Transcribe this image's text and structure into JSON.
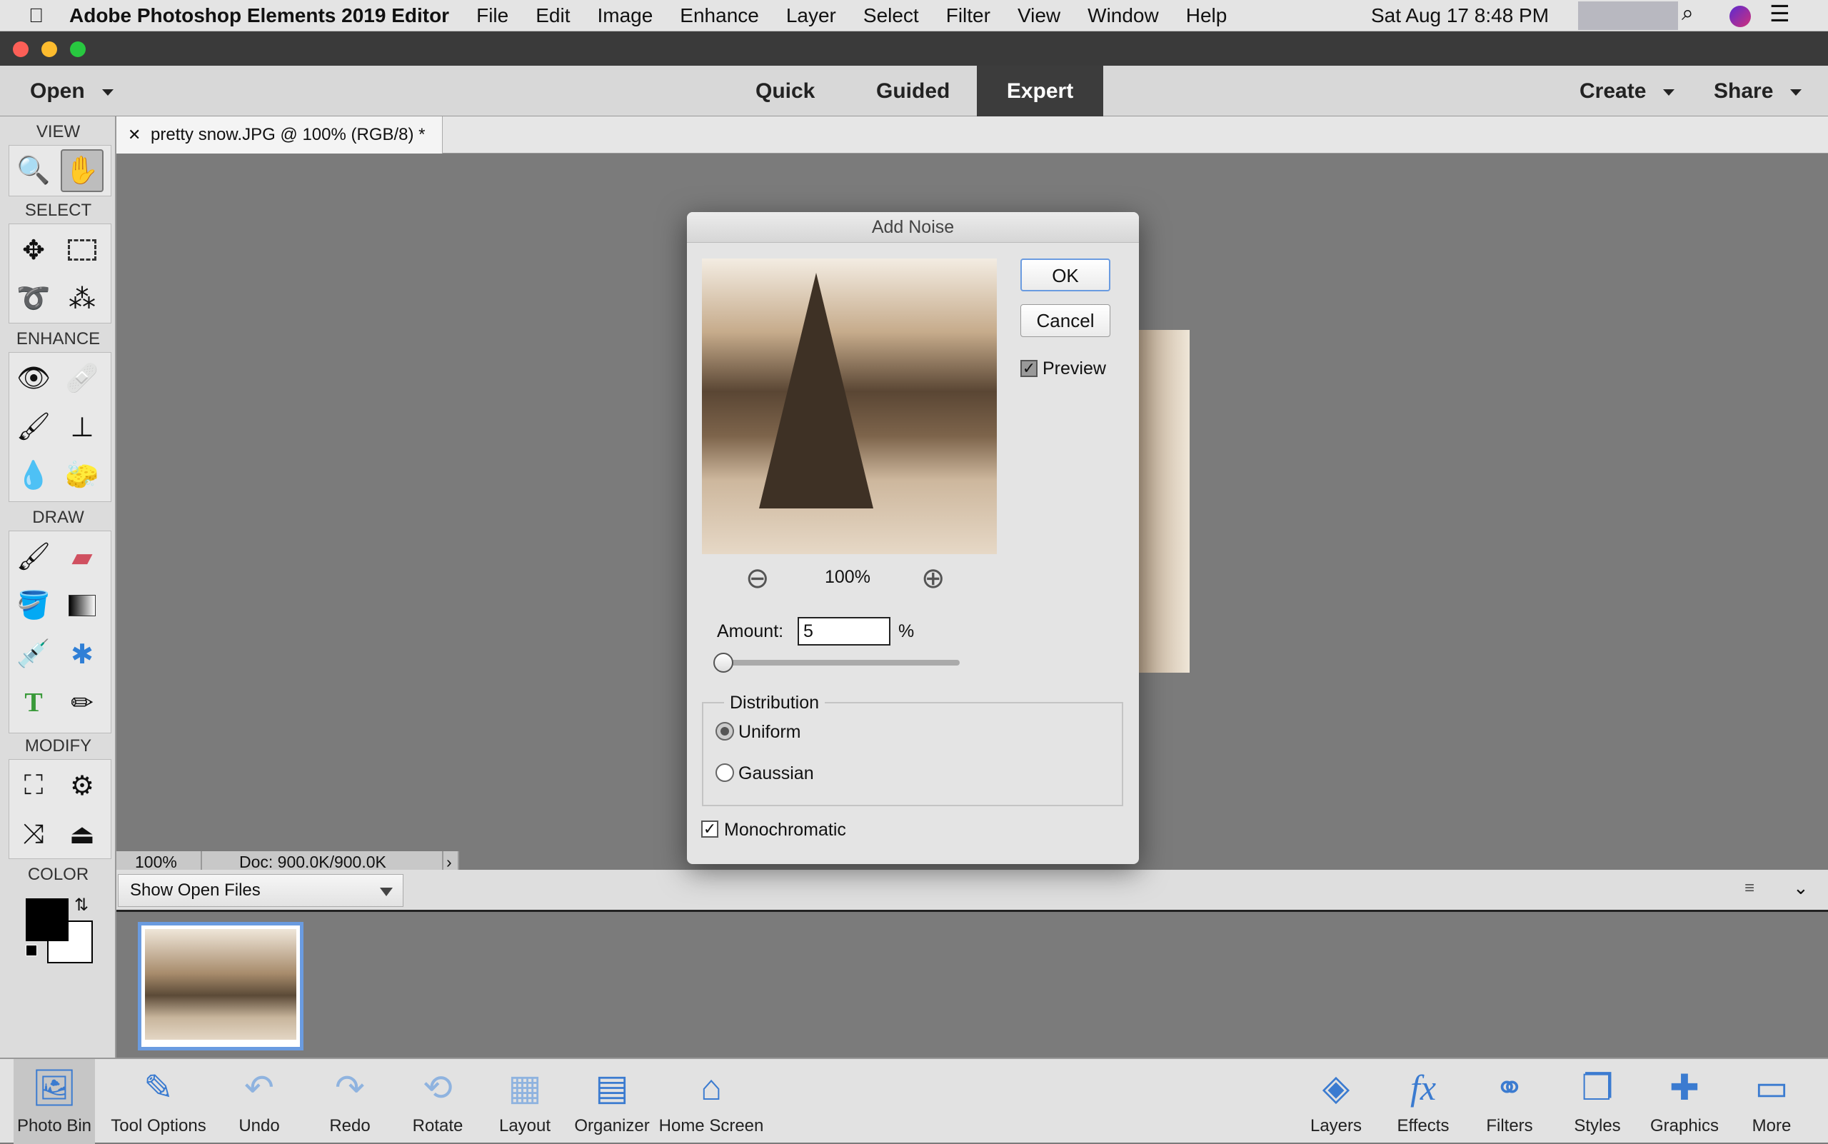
{
  "menubar": {
    "app": "Adobe Photoshop Elements 2019 Editor",
    "items": [
      "File",
      "Edit",
      "Image",
      "Enhance",
      "Layer",
      "Select",
      "Filter",
      "View",
      "Window",
      "Help"
    ],
    "datetime": "Sat Aug 17  8:48 PM"
  },
  "toolbar": {
    "open": "Open",
    "modes": [
      "Quick",
      "Guided",
      "Expert"
    ],
    "active_mode": "Expert",
    "create": "Create",
    "share": "Share"
  },
  "toolbox": {
    "sections": [
      "VIEW",
      "SELECT",
      "ENHANCE",
      "DRAW",
      "MODIFY",
      "COLOR"
    ],
    "foreground": "#000000",
    "background": "#ffffff"
  },
  "document": {
    "tab": "pretty snow.JPG @ 100% (RGB/8) *",
    "zoom": "100%",
    "doc_size": "Doc: 900.0K/900.0K"
  },
  "bin": {
    "selector": "Show Open Files"
  },
  "taskbar": {
    "left": [
      "Photo Bin",
      "Tool Options",
      "Undo",
      "Redo",
      "Rotate",
      "Layout",
      "Organizer",
      "Home Screen"
    ],
    "right": [
      "Layers",
      "Effects",
      "Filters",
      "Styles",
      "Graphics",
      "More"
    ]
  },
  "dialog": {
    "title": "Add Noise",
    "ok": "OK",
    "cancel": "Cancel",
    "preview_label": "Preview",
    "preview_checked": true,
    "zoom": "100%",
    "amount_label": "Amount:",
    "amount_value": "5",
    "amount_unit": "%",
    "amount_percent": 5,
    "distribution_label": "Distribution",
    "uniform": "Uniform",
    "gaussian": "Gaussian",
    "selected_distribution": "Uniform",
    "monochromatic": "Monochromatic",
    "monochromatic_checked": true
  }
}
